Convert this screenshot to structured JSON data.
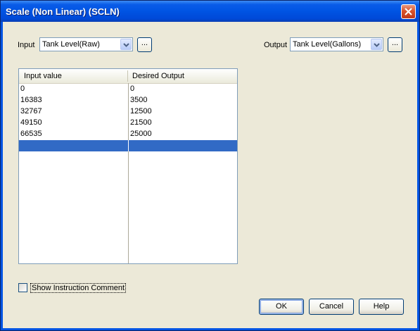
{
  "window": {
    "title": "Scale (Non Linear) (SCLN)"
  },
  "input": {
    "label": "Input",
    "value": "Tank Level(Raw)",
    "browse_label": "..."
  },
  "output": {
    "label": "Output",
    "value": "Tank Level(Gallons)",
    "browse_label": "..."
  },
  "table": {
    "columns": [
      "Input value",
      "Desired Output"
    ],
    "rows": [
      [
        "0",
        "0"
      ],
      [
        "16383",
        "3500"
      ],
      [
        "32767",
        "12500"
      ],
      [
        "49150",
        "21500"
      ],
      [
        "66535",
        "25000"
      ]
    ],
    "selected_empty_row": true
  },
  "options": {
    "show_comment_label": "Show Instruction Comment",
    "show_comment_checked": false
  },
  "buttons": {
    "ok": "OK",
    "cancel": "Cancel",
    "help": "Help"
  },
  "colors": {
    "selection": "#316ac5",
    "titlebar": "#0054e3",
    "client_bg": "#ece9d8"
  }
}
